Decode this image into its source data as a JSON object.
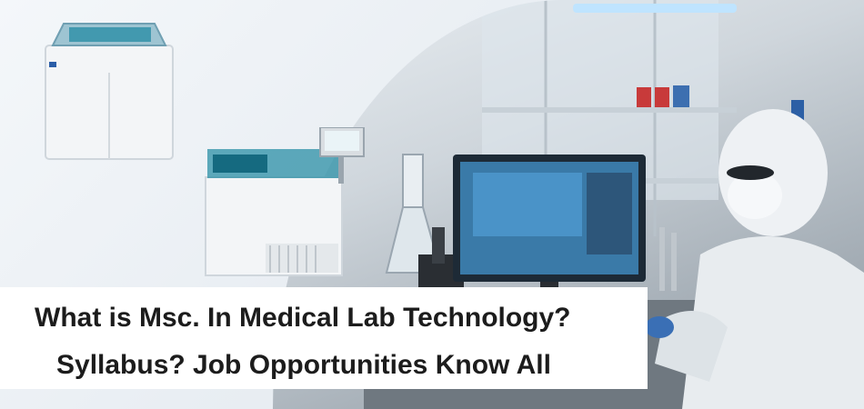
{
  "banner": {
    "title_line1": "What is Msc. In Medical Lab Technology?",
    "title_line2": "Syllabus? Job Opportunities Know All"
  },
  "colors": {
    "text": "#1c1c1c",
    "title_box_bg": "#ffffff",
    "analyzer_teal": "#2b8fa6",
    "suit_white": "#eef1f4",
    "monitor_screen": "#3a7aa8"
  },
  "icons": [
    "lab-analyzer-large",
    "lab-analyzer-small",
    "lab-monitor",
    "lab-scientist",
    "glass-flask",
    "microscope"
  ]
}
